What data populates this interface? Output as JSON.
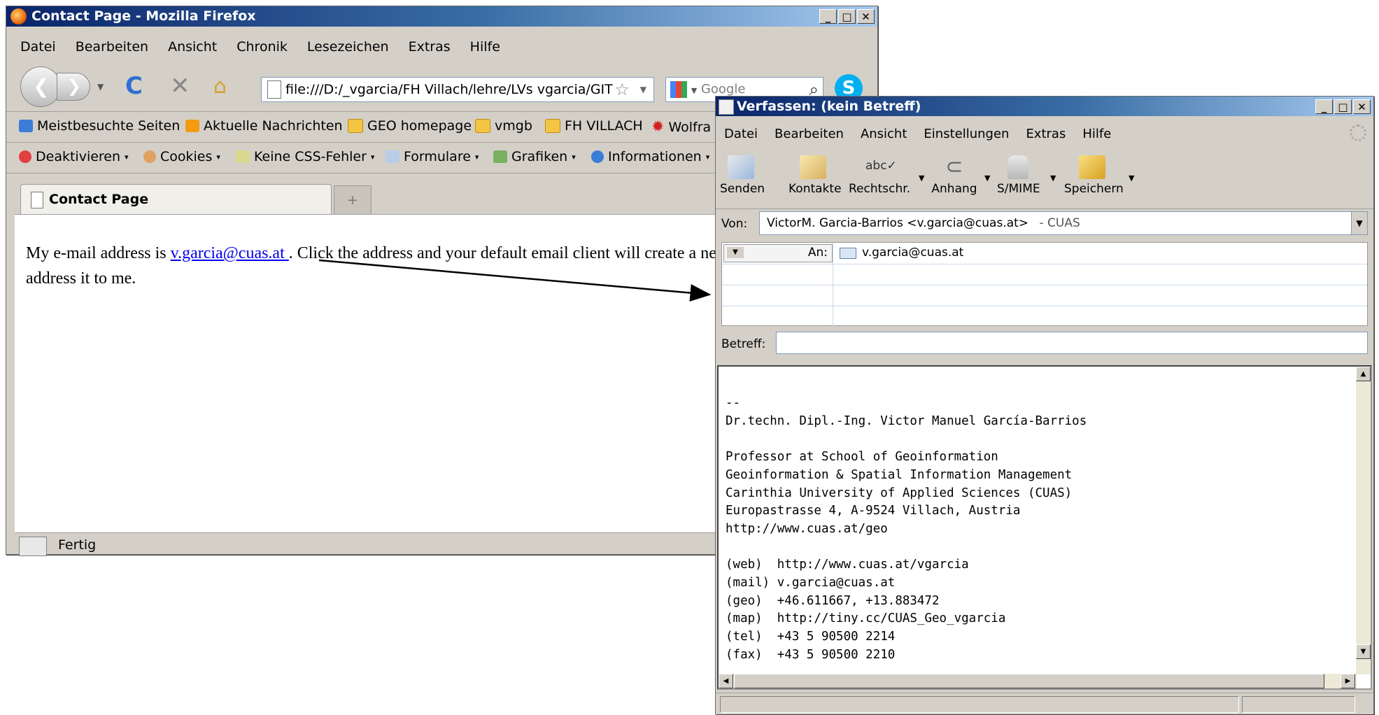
{
  "firefox": {
    "title": "Contact Page - Mozilla Firefox",
    "menu": [
      "Datei",
      "Bearbeiten",
      "Ansicht",
      "Chronik",
      "Lesezeichen",
      "Extras",
      "Hilfe"
    ],
    "url": "file:///D:/_vgarcia/FH Villach/lehre/LVs vgarcia/GIT",
    "search_placeholder": "Google",
    "bookmarks": [
      "Meistbesuchte Seiten",
      "Aktuelle Nachrichten",
      "GEO homepage",
      "vmgb",
      "FH VILLACH",
      "Wolfra"
    ],
    "devbar": [
      "Deaktivieren",
      "Cookies",
      "Keine CSS-Fehler",
      "Formulare",
      "Grafiken",
      "Informationen"
    ],
    "tab_title": "Contact Page",
    "page": {
      "text_before": "My e-mail address is ",
      "email_link": "v.garcia@cuas.at ",
      "text_after": ". Click the address and your default email client will create a new message and address it to me."
    },
    "status_text": "Fertig"
  },
  "compose": {
    "title": "Verfassen: (kein Betreff)",
    "menu": [
      "Datei",
      "Bearbeiten",
      "Ansicht",
      "Einstellungen",
      "Extras",
      "Hilfe"
    ],
    "toolbar": [
      "Senden",
      "Kontakte",
      "Rechtschr.",
      "Anhang",
      "S/MIME",
      "Speichern"
    ],
    "from_label": "Von:",
    "from_value": "VictorM. Garcia-Barrios <v.garcia@cuas.at>",
    "from_account": "- CUAS",
    "to_label": "An:",
    "to_value": "v.garcia@cuas.at",
    "subject_label": "Betreff:",
    "subject_value": "",
    "body": "--\nDr.techn. Dipl.-Ing. Victor Manuel García-Barrios\n\nProfessor at School of Geoinformation\nGeoinformation & Spatial Information Management\nCarinthia University of Applied Sciences (CUAS)\nEuropastrasse 4, A-9524 Villach, Austria\nhttp://www.cuas.at/geo\n\n(web)  http://www.cuas.at/vgarcia\n(mail) v.garcia@cuas.at\n(geo)  +46.611667, +13.883472\n(map)  http://tiny.cc/CUAS_Geo_vgarcia\n(tel)  +43 5 90500 2214\n(fax)  +43 5 90500 2210"
  }
}
